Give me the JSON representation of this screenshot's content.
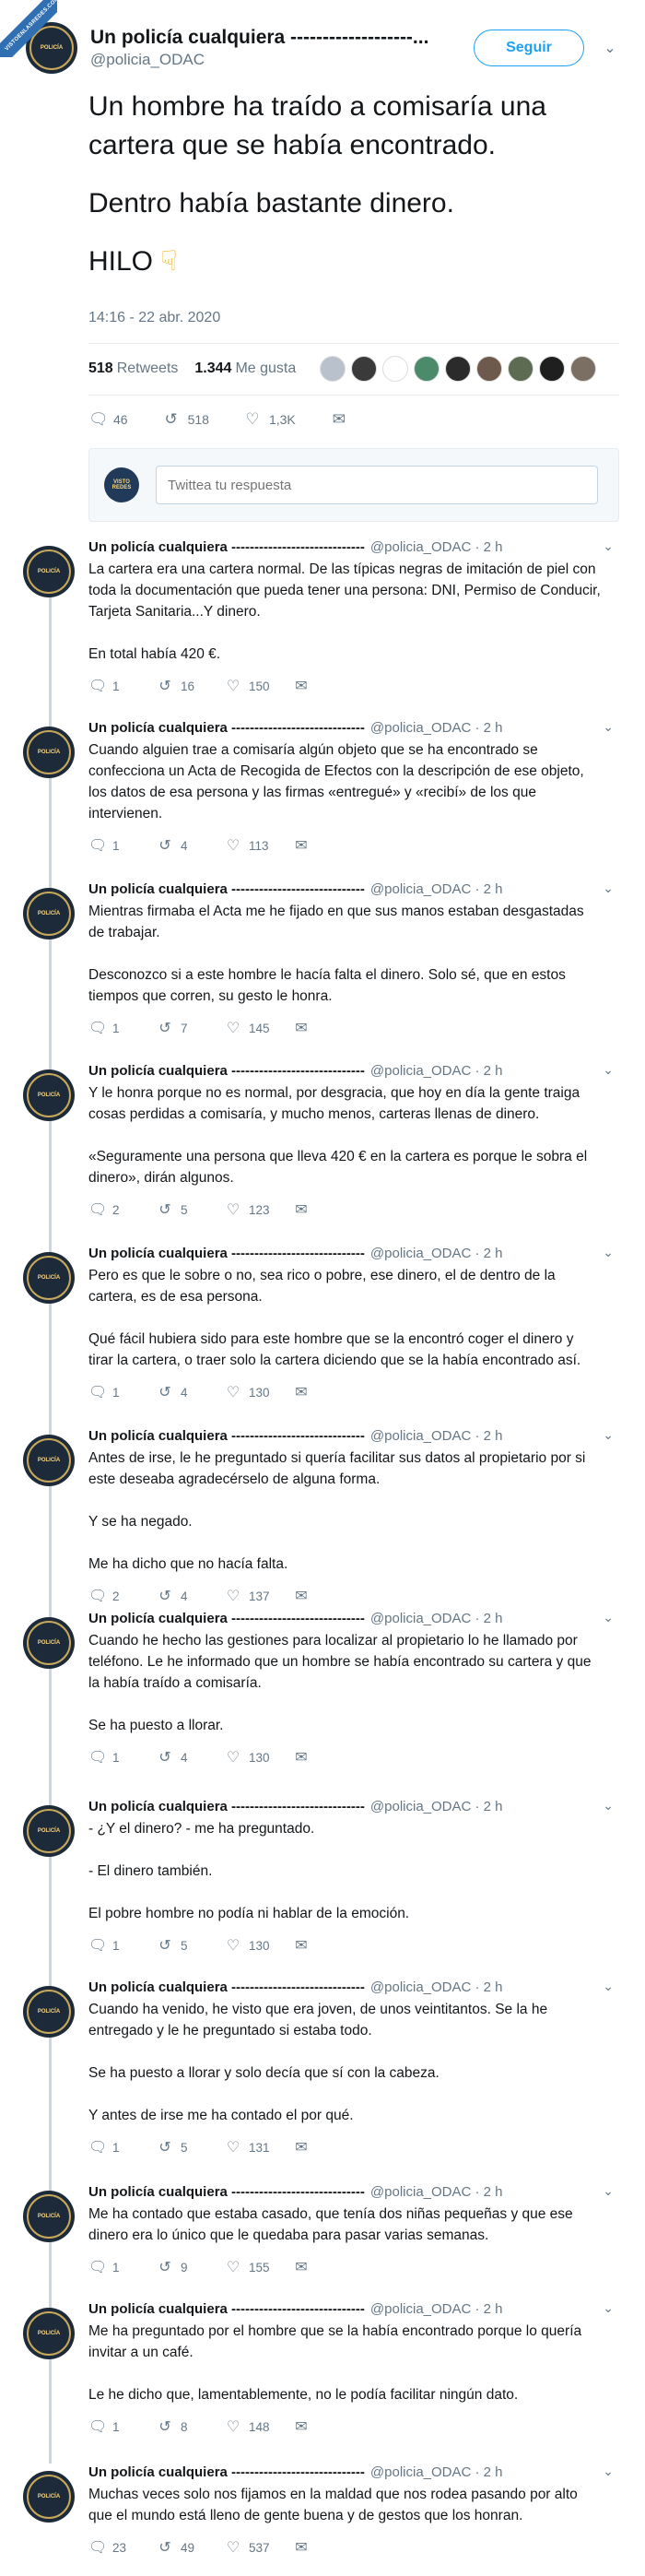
{
  "watermark": "VISTOENLASREDES.COM",
  "main": {
    "display_name": "Un policía cualquiera -------------------...",
    "handle": "@policia_ODAC",
    "follow_label": "Seguir",
    "paragraphs": [
      "Un hombre ha traído a comisaría una",
      "cartera que se había encontrado.",
      "Dentro había bastante dinero.",
      "HILO"
    ],
    "timestamp": "14:16 - 22 abr. 2020",
    "retweets_count": "518",
    "retweets_label": "Retweets",
    "likes_count": "1.344",
    "likes_label": "Me gusta",
    "replies": "46",
    "retweets": "518",
    "likes": "1,3K",
    "reply_placeholder": "Twittea tu respuesta",
    "reply_avatar_text": "VISTO REDES"
  },
  "likers": [
    {
      "color": "#b9c2cc"
    },
    {
      "color": "#3a3a3a"
    },
    {
      "color": "#ffffff"
    },
    {
      "color": "#4b8a6b"
    },
    {
      "color": "#2b2b2b"
    },
    {
      "color": "#6e5a4c"
    },
    {
      "color": "#5c6b52"
    },
    {
      "color": "#1f1f1f"
    },
    {
      "color": "#7b6e62"
    }
  ],
  "thread": [
    {
      "name": "Un policía cualquiera -----------------------------",
      "meta": "@policia_ODAC · 2 h",
      "text": [
        [
          "La cartera era una cartera normal. De las típicas negras de imitación de piel con",
          "toda la documentación que pueda tener una persona: DNI, Permiso de Conducir,",
          "Tarjeta Sanitaria...Y dinero."
        ],
        [
          "En total había 420 €."
        ]
      ],
      "replies": "1",
      "retweets": "16",
      "likes": "150"
    },
    {
      "name": "Un policía cualquiera -----------------------------",
      "meta": "@policia_ODAC · 2 h",
      "text": [
        [
          "Cuando alguien trae a comisaría algún objeto que se ha encontrado se",
          "confecciona un Acta de Recogida de Efectos con la descripción de ese objeto,",
          "los datos de esa persona y las firmas «entregué» y «recibí» de los que",
          "intervienen."
        ]
      ],
      "replies": "1",
      "retweets": "4",
      "likes": "113"
    },
    {
      "name": "Un policía cualquiera -----------------------------",
      "meta": "@policia_ODAC · 2 h",
      "text": [
        [
          "Mientras firmaba el Acta me he fijado en que sus manos estaban desgastadas",
          "de trabajar."
        ],
        [
          "Desconozco si a este hombre le hacía falta el dinero. Solo sé, que en estos",
          "tiempos que corren, su gesto le honra."
        ]
      ],
      "replies": "1",
      "retweets": "7",
      "likes": "145"
    },
    {
      "name": "Un policía cualquiera -----------------------------",
      "meta": "@policia_ODAC · 2 h",
      "text": [
        [
          "Y le honra porque no es normal, por desgracia, que hoy en día la gente traiga",
          "cosas perdidas a comisaría, y mucho menos, carteras llenas de dinero."
        ],
        [
          "«Seguramente una persona que lleva 420 € en la cartera es porque le sobra el",
          "dinero», dirán algunos."
        ]
      ],
      "replies": "2",
      "retweets": "5",
      "likes": "123"
    },
    {
      "name": "Un policía cualquiera -----------------------------",
      "meta": "@policia_ODAC · 2 h",
      "text": [
        [
          "Pero es que le sobre o no, sea rico o pobre, ese dinero, el de dentro de la",
          "cartera, es de esa persona."
        ],
        [
          "Qué fácil hubiera sido para este hombre que se la encontró coger el dinero y",
          "tirar la cartera, o traer solo la cartera diciendo que se la había encontrado así."
        ]
      ],
      "replies": "1",
      "retweets": "4",
      "likes": "130"
    },
    {
      "name": "Un policía cualquiera -----------------------------",
      "meta": "@policia_ODAC · 2 h",
      "text": [
        [
          "Antes de irse, le he preguntado si quería facilitar sus datos al propietario por si",
          "este deseaba agradecérselo de alguna forma."
        ],
        [
          "Y se ha negado."
        ],
        [
          "Me ha dicho que no hacía falta."
        ]
      ],
      "replies": "2",
      "retweets": "4",
      "likes": "137"
    },
    {
      "name": "Un policía cualquiera -----------------------------",
      "meta": "@policia_ODAC · 2 h",
      "text": [
        [
          "Cuando he hecho las gestiones para localizar al propietario lo he llamado por",
          "teléfono. Le he informado que un hombre se había encontrado su cartera y que",
          "la había traído a comisaría."
        ],
        [
          "Se ha puesto a llorar."
        ]
      ],
      "replies": "1",
      "retweets": "4",
      "likes": "130"
    },
    {
      "name": "Un policía cualquiera -----------------------------",
      "meta": "@policia_ODAC · 2 h",
      "text": [
        [
          "- ¿Y el dinero? - me ha preguntado."
        ],
        [
          "- El dinero también."
        ],
        [
          "El pobre hombre no podía ni hablar de la emoción."
        ]
      ],
      "replies": "1",
      "retweets": "5",
      "likes": "130"
    },
    {
      "name": "Un policía cualquiera -----------------------------",
      "meta": "@policia_ODAC · 2 h",
      "text": [
        [
          "Cuando ha venido, he visto que era joven, de unos veintitantos. Se la he",
          "entregado y le he preguntado si estaba todo."
        ],
        [
          "Se ha puesto a llorar y solo decía que sí con la cabeza."
        ],
        [
          "Y antes de irse me ha contado el por qué."
        ]
      ],
      "replies": "1",
      "retweets": "5",
      "likes": "131"
    },
    {
      "name": "Un policía cualquiera -----------------------------",
      "meta": "@policia_ODAC · 2 h",
      "text": [
        [
          "Me ha contado que estaba casado, que tenía dos niñas pequeñas y que ese",
          "dinero era lo único que le quedaba para pasar varias semanas."
        ]
      ],
      "replies": "1",
      "retweets": "9",
      "likes": "155"
    },
    {
      "name": "Un policía cualquiera -----------------------------",
      "meta": "@policia_ODAC · 2 h",
      "text": [
        [
          "Me ha preguntado por el hombre que se la había encontrado porque lo quería",
          "invitar a un café."
        ],
        [
          "Le he dicho que, lamentablemente, no le podía facilitar ningún dato."
        ]
      ],
      "replies": "1",
      "retweets": "8",
      "likes": "148"
    },
    {
      "name": "Un policía cualquiera -----------------------------",
      "meta": "@policia_ODAC · 2 h",
      "text": [
        [
          "Muchas veces solo nos fijamos en la maldad que nos rodea pasando por alto",
          "que el mundo está lleno de gente buena y de gestos que los honran."
        ]
      ],
      "replies": "23",
      "retweets": "49",
      "likes": "537"
    }
  ]
}
